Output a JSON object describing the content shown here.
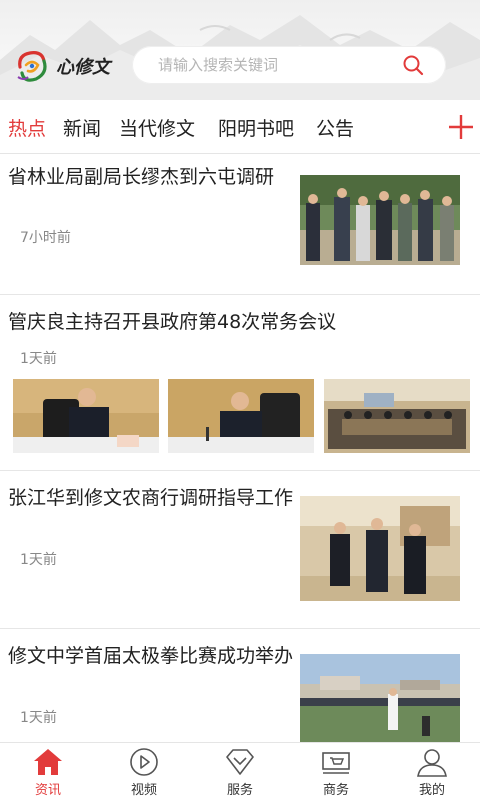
{
  "header": {
    "logo_text": "心修文",
    "search_placeholder": "请输入搜索关键词"
  },
  "tabs": [
    {
      "label": "热点",
      "active": true
    },
    {
      "label": "新闻",
      "active": false
    },
    {
      "label": "当代修文",
      "active": false
    },
    {
      "label": "阳明书吧",
      "active": false
    },
    {
      "label": "公告",
      "active": false
    }
  ],
  "news": [
    {
      "title": "省林业局副局长缪杰到六屯调研",
      "time": "7小时前"
    },
    {
      "title": "管庆良主持召开县政府第48次常务会议",
      "time": "1天前"
    },
    {
      "title": "张江华到修文农商行调研指导工作",
      "time": "1天前"
    },
    {
      "title": "修文中学首届太极拳比赛成功举办",
      "time": "1天前"
    }
  ],
  "bottom_nav": [
    {
      "label": "资讯",
      "icon": "home-icon",
      "active": true
    },
    {
      "label": "视频",
      "icon": "play-icon",
      "active": false
    },
    {
      "label": "服务",
      "icon": "diamond-icon",
      "active": false
    },
    {
      "label": "商务",
      "icon": "cart-icon",
      "active": false
    },
    {
      "label": "我的",
      "icon": "user-icon",
      "active": false
    }
  ],
  "colors": {
    "accent": "#e23b3b"
  }
}
